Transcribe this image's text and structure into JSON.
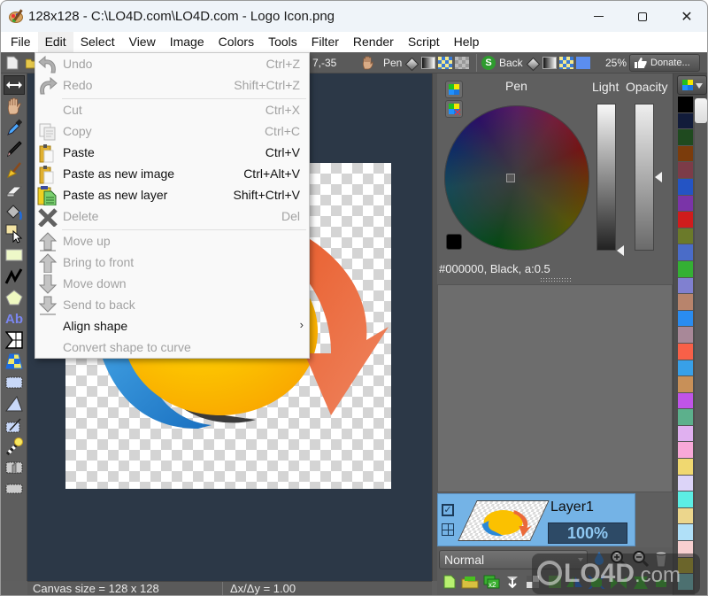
{
  "window": {
    "title": "128x128 - C:\\LO4D.com\\LO4D.com - Logo Icon.png",
    "controls": {
      "minimize": "minimize",
      "maximize": "maximize",
      "close": "✕"
    }
  },
  "menubar": {
    "items": [
      "File",
      "Edit",
      "Select",
      "View",
      "Image",
      "Colors",
      "Tools",
      "Filter",
      "Render",
      "Script",
      "Help"
    ],
    "active": "Edit"
  },
  "toolbar": {
    "coords": "7,-35",
    "pen_label": "Pen",
    "back_label": "Back",
    "zoom": "25%",
    "donate_label": "Donate..."
  },
  "edit_menu": {
    "items": [
      {
        "label": "Undo",
        "shortcut": "Ctrl+Z",
        "enabled": false,
        "icon": "undo-icon"
      },
      {
        "label": "Redo",
        "shortcut": "Shift+Ctrl+Z",
        "enabled": false,
        "icon": "redo-icon"
      },
      {
        "label": "Cut",
        "shortcut": "Ctrl+X",
        "enabled": false,
        "icon": ""
      },
      {
        "label": "Copy",
        "shortcut": "Ctrl+C",
        "enabled": false,
        "icon": "copy-icon"
      },
      {
        "label": "Paste",
        "shortcut": "Ctrl+V",
        "enabled": true,
        "icon": "clipboard-icon"
      },
      {
        "label": "Paste as new image",
        "shortcut": "Ctrl+Alt+V",
        "enabled": true,
        "icon": "clipboard-icon"
      },
      {
        "label": "Paste as new layer",
        "shortcut": "Shift+Ctrl+V",
        "enabled": true,
        "icon": "paste-layer-icon"
      },
      {
        "label": "Delete",
        "shortcut": "Del",
        "enabled": false,
        "icon": "delete-x-icon"
      },
      {
        "label": "Move up",
        "shortcut": "",
        "enabled": false,
        "icon": "move-up-icon"
      },
      {
        "label": "Bring to front",
        "shortcut": "",
        "enabled": false,
        "icon": "bring-to-front-icon"
      },
      {
        "label": "Move down",
        "shortcut": "",
        "enabled": false,
        "icon": "move-down-icon"
      },
      {
        "label": "Send to back",
        "shortcut": "",
        "enabled": false,
        "icon": "send-to-back-icon"
      },
      {
        "label": "Align shape",
        "shortcut": "",
        "enabled": true,
        "submenu": true,
        "icon": ""
      },
      {
        "label": "Convert shape to curve",
        "shortcut": "",
        "enabled": false,
        "icon": ""
      }
    ],
    "submenu_arrow": "›"
  },
  "color_panel": {
    "title": "Pen",
    "light_label": "Light",
    "opacity_label": "Opacity",
    "color_info": "#000000, Black, a:0.5",
    "lightness": 0.0,
    "opacity": 0.5
  },
  "layers": {
    "items": [
      {
        "name": "Layer1",
        "opacity": "100%",
        "visible": true
      }
    ],
    "blend_mode": "Normal",
    "visible_check": "✓"
  },
  "palette": {
    "colors": [
      "#000000",
      "#121c3a",
      "#1f4a1f",
      "#7b3c0c",
      "#7c3c48",
      "#2454c4",
      "#7a34a8",
      "#d01c1c",
      "#6b7a2a",
      "#4a6cc8",
      "#34b034",
      "#8080d0",
      "#b8846c",
      "#2a8cf0",
      "#a88898",
      "#f86048",
      "#38a0e8",
      "#c89058",
      "#c054e8",
      "#5cb08c",
      "#e0b0f0",
      "#f8a8d8",
      "#f0d870",
      "#dcd4f8",
      "#5ceee4",
      "#ecd68c",
      "#b0e0f8",
      "#f8d0d0",
      "#bcb030",
      "#78c8c8"
    ]
  },
  "statusbar": {
    "canvas_size": "Canvas size = 128 x 128",
    "ratio": "Δx/Δy = 1.00"
  },
  "watermark": {
    "brand": "LO4D",
    "suffix": ".com"
  }
}
